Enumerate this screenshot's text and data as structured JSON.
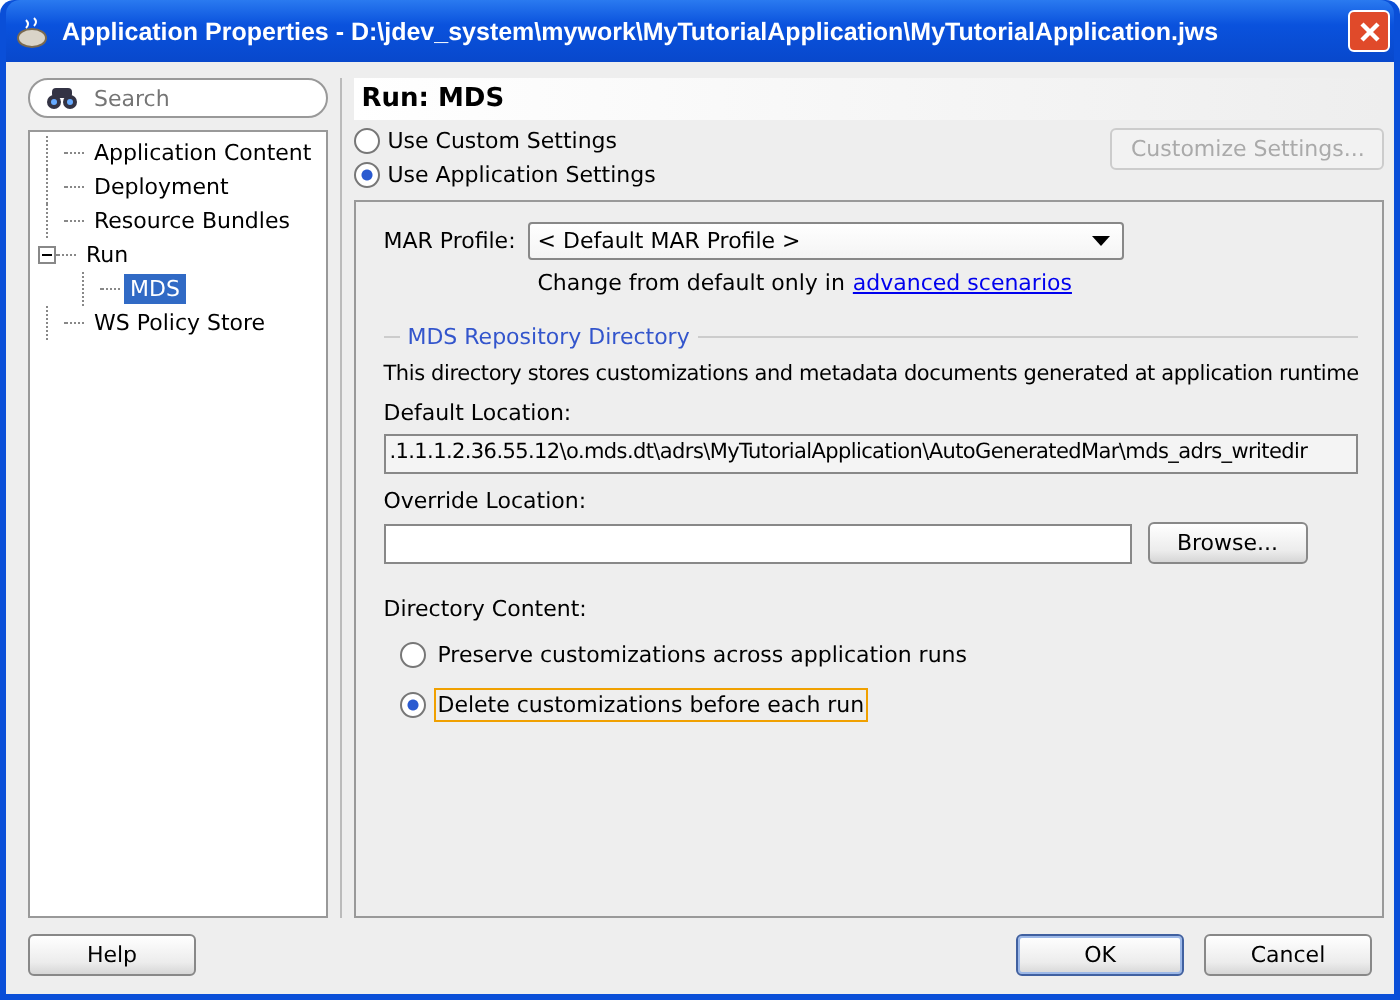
{
  "window": {
    "title": "Application Properties - D:\\jdev_system\\mywork\\MyTutorialApplication\\MyTutorialApplication.jws"
  },
  "search": {
    "placeholder": "Search"
  },
  "tree": [
    {
      "label": "Application Content",
      "selected": false
    },
    {
      "label": "Deployment",
      "selected": false
    },
    {
      "label": "Resource Bundles",
      "selected": false
    },
    {
      "label": "Run",
      "selected": false,
      "expanded": true,
      "children": [
        {
          "label": "MDS",
          "selected": true
        }
      ]
    },
    {
      "label": "WS Policy Store",
      "selected": false
    }
  ],
  "page": {
    "title": "Run: MDS",
    "settings_options": [
      {
        "label": "Use Custom Settings",
        "selected": false
      },
      {
        "label": "Use Application Settings",
        "selected": true
      }
    ],
    "customize_button": {
      "label": "Customize Settings...",
      "disabled": true
    },
    "mar_profile": {
      "label": "MAR Profile:",
      "value": "< Default MAR Profile >"
    },
    "hint": {
      "text": "Change from default only in",
      "link": "advanced scenarios"
    },
    "repository": {
      "legend": "MDS Repository Directory",
      "description": "This directory stores customizations and metadata documents generated at application runtime",
      "default_location": {
        "label": "Default Location:",
        "value": ".1.1.1.2.36.55.12\\o.mds.dt\\adrs\\MyTutorialApplication\\AutoGeneratedMar\\mds_adrs_writedir"
      },
      "override_location": {
        "label": "Override Location:"
      },
      "browse_button": "Browse...",
      "content_label": "Directory Content:",
      "content_options": [
        {
          "label": "Preserve customizations across application runs",
          "selected": false,
          "focused": false
        },
        {
          "label": "Delete customizations before each run",
          "selected": true,
          "focused": true
        }
      ]
    }
  },
  "buttons": [
    {
      "label": "Help",
      "kind": "help",
      "default": false
    },
    {
      "label": "OK",
      "kind": "action",
      "default": true
    },
    {
      "label": "Cancel",
      "kind": "action",
      "default": false
    }
  ]
}
